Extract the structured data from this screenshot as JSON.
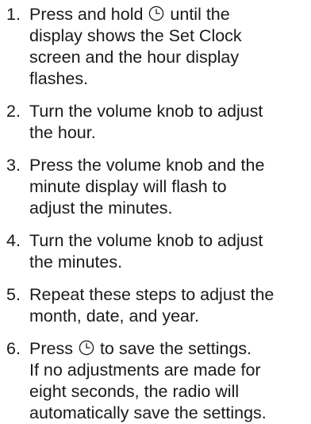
{
  "steps": [
    {
      "number": "1.",
      "line1_before_icon": "Press and hold",
      "icon": "clock-icon",
      "line1_after_icon": "until the",
      "line2": "display shows the Set Clock",
      "line3": "screen and the hour display",
      "line4": "flashes."
    },
    {
      "number": "2.",
      "line1": "Turn the volume knob to adjust",
      "line2": "the hour."
    },
    {
      "number": "3.",
      "line1": "Press the volume knob and the",
      "line2": "minute display will flash to",
      "line3": "adjust the minutes."
    },
    {
      "number": "4.",
      "line1": "Turn the volume knob to adjust",
      "line2": "the minutes."
    },
    {
      "number": "5.",
      "line1": "Repeat these steps to adjust the",
      "line2": "month, date, and year."
    },
    {
      "number": "6.",
      "line1_before_icon": "Press",
      "icon": "clock-icon",
      "line1_after_icon": "to save the settings.",
      "line2": "If no adjustments are made for",
      "line3": "eight seconds, the radio will",
      "line4": "automatically save the settings."
    }
  ]
}
